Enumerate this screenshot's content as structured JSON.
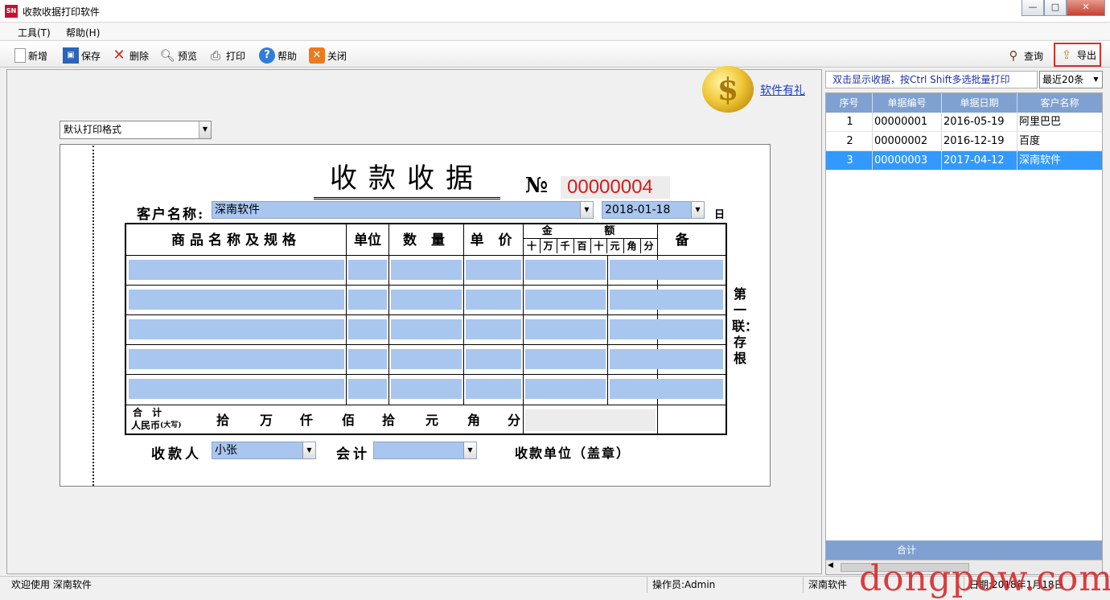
{
  "window": {
    "title": "收款收据打印软件",
    "icon_text": "SN",
    "controls": {
      "minimize": "—",
      "maximize": "□",
      "close": "✕"
    }
  },
  "menu": [
    {
      "label": "工具(T)"
    },
    {
      "label": "帮助(H)"
    }
  ],
  "toolbar": {
    "new": "新增",
    "save": "保存",
    "delete": "删除",
    "preview": "预览",
    "print": "打印",
    "help": "帮助",
    "close": "关闭",
    "query": "查询",
    "export": "导出"
  },
  "promo": {
    "coin_glyph": "$",
    "link": "软件有礼"
  },
  "format_select": "默认打印格式",
  "receipt": {
    "title": "收款收据",
    "no_symbol": "№",
    "number": "00000004",
    "customer_label": "客户名称:",
    "customer_value": "深南软件",
    "date_value": "2018-01-18",
    "day_label": "日",
    "headers": {
      "item": "商品名称及规格",
      "unit": "单位",
      "qty": "数 量",
      "price": "单 价",
      "amount": "金 额",
      "remark": "备 注",
      "digits": [
        "十",
        "万",
        "千",
        "百",
        "十",
        "元",
        "角",
        "分"
      ]
    },
    "total_line1": "合 计",
    "total_line2": "人民币",
    "total_caps": "(大写)",
    "total_units": [
      "拾",
      "万",
      "仟",
      "佰",
      "拾",
      "元",
      "角",
      "分"
    ],
    "payee_label": "收款人",
    "payee_value": "小张",
    "accountant_label": "会计",
    "accountant_value": "",
    "unit_label": "收款单位（盖章）",
    "side_label": "第一联：存根"
  },
  "right_panel": {
    "hint": "双击显示收据，按Ctrl Shift多选批量打印",
    "recent": "最近20条",
    "columns": [
      "序号",
      "单据编号",
      "单据日期",
      "客户名称"
    ],
    "rows": [
      [
        "1",
        "00000001",
        "2016-05-19",
        "阿里巴巴"
      ],
      [
        "2",
        "00000002",
        "2016-12-19",
        "百度"
      ],
      [
        "3",
        "00000003",
        "2017-04-12",
        "深南软件"
      ]
    ],
    "selected_row": 2,
    "footer": "合计"
  },
  "status": {
    "welcome": "欢迎使用 深南软件",
    "operator": "操作员:Admin",
    "company": "深南软件",
    "date": "日期:2018年1月18日"
  },
  "watermark": "dongpow.com",
  "colors": {
    "field": "#a9c6ef",
    "grid_header": "#7fa1d1",
    "selected": "#3399ff",
    "number": "#d51c1c"
  }
}
